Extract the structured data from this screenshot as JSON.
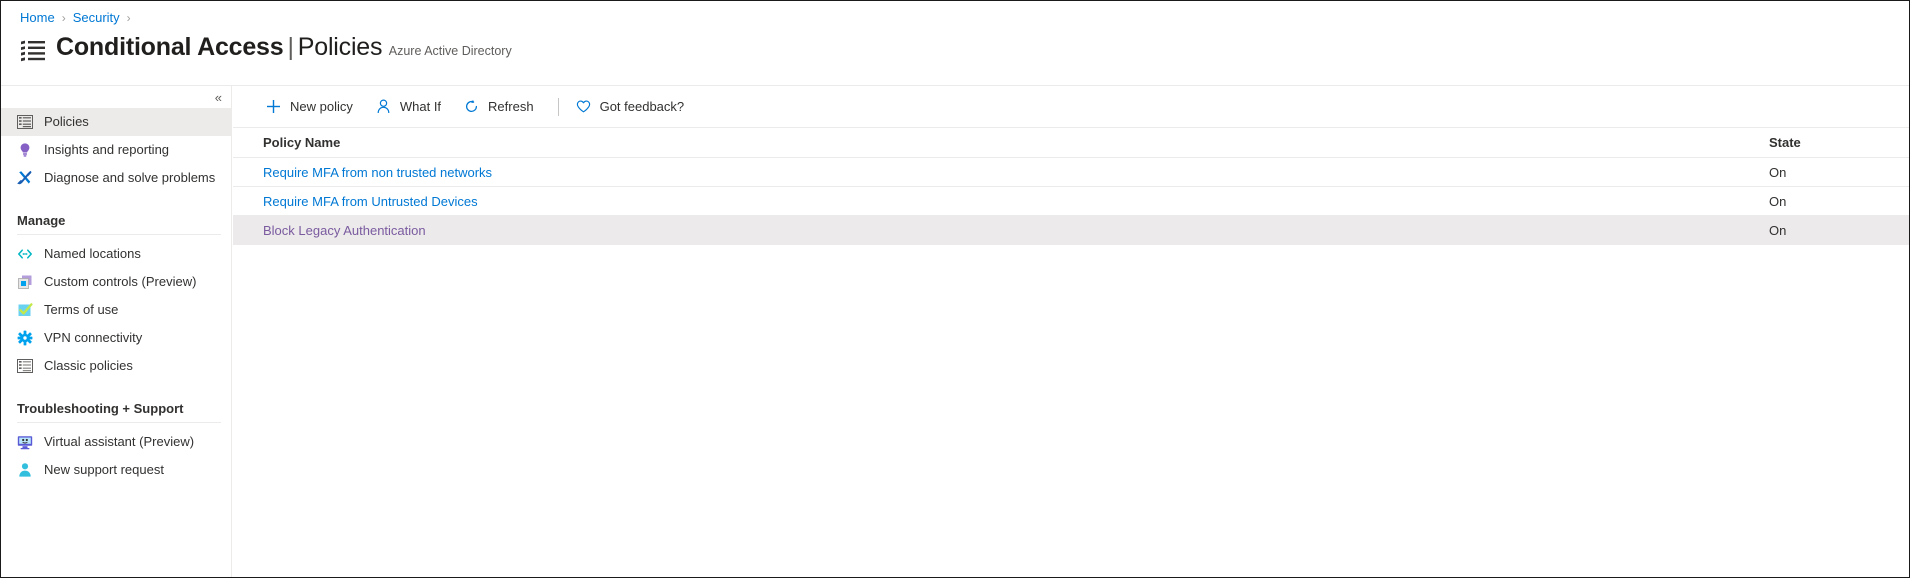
{
  "breadcrumb": {
    "items": [
      {
        "label": "Home"
      },
      {
        "label": "Security"
      }
    ],
    "separator": "›"
  },
  "header": {
    "icon": "policy-list-icon",
    "title": "Conditional Access",
    "separator": "|",
    "subpage": "Policies",
    "subtitle": "Azure Active Directory"
  },
  "sidebar": {
    "collapse_label": "«",
    "top_items": [
      {
        "label": "Policies",
        "icon": "policy-list-icon",
        "selected": true
      },
      {
        "label": "Insights and reporting",
        "icon": "lightbulb-icon",
        "selected": false
      },
      {
        "label": "Diagnose and solve problems",
        "icon": "wrench-screwdriver-icon",
        "selected": false
      }
    ],
    "groups": [
      {
        "title": "Manage",
        "items": [
          {
            "label": "Named locations",
            "icon": "code-brackets-icon"
          },
          {
            "label": "Custom controls (Preview)",
            "icon": "custom-control-icon"
          },
          {
            "label": "Terms of use",
            "icon": "checkbox-checked-icon"
          },
          {
            "label": "VPN connectivity",
            "icon": "gear-icon"
          },
          {
            "label": "Classic policies",
            "icon": "classic-list-icon"
          }
        ]
      },
      {
        "title": "Troubleshooting + Support",
        "items": [
          {
            "label": "Virtual assistant (Preview)",
            "icon": "monitor-assistant-icon"
          },
          {
            "label": "New support request",
            "icon": "person-support-icon"
          }
        ]
      }
    ]
  },
  "toolbar": {
    "commands": [
      {
        "label": "New policy",
        "icon": "plus-icon"
      },
      {
        "label": "What If",
        "icon": "person-icon"
      },
      {
        "label": "Refresh",
        "icon": "refresh-icon"
      }
    ],
    "feedback": {
      "label": "Got feedback?",
      "icon": "heart-icon"
    }
  },
  "table": {
    "columns": [
      {
        "key": "name",
        "label": "Policy Name"
      },
      {
        "key": "state",
        "label": "State"
      }
    ],
    "rows": [
      {
        "name": "Require MFA from non trusted networks",
        "state": "On",
        "visited": false,
        "zebra": false
      },
      {
        "name": "Require MFA from Untrusted Devices",
        "state": "On",
        "visited": false,
        "zebra": false
      },
      {
        "name": "Block Legacy Authentication",
        "state": "On",
        "visited": true,
        "zebra": true
      }
    ]
  },
  "colors": {
    "accent": "#0078d4",
    "link": "#0078d4",
    "visited_link": "#7a5ba0",
    "selected_row": "#edebe9",
    "zebra_row": "#eceaea",
    "hairline": "#edebe9",
    "text": "#323130",
    "muted_text": "#605e5c"
  }
}
